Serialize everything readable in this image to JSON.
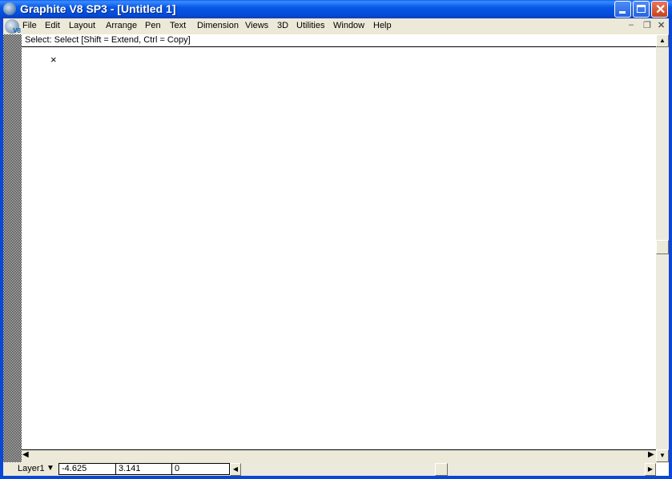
{
  "window": {
    "title": "Graphite V8 SP3 - [Untitled 1]",
    "minimize_icon": "minimize-icon",
    "maximize_icon": "maximize-icon",
    "close_icon": "close-icon"
  },
  "menubar": {
    "items": [
      "File",
      "Edit",
      "Layout",
      "Arrange",
      "Pen",
      "Text",
      "Dimension",
      "Views",
      "3D",
      "Utilities",
      "Window",
      "Help"
    ],
    "doc_icon_badge": "V8"
  },
  "prompt": {
    "text": "Select: Select  [Shift = Extend, Ctrl = Copy]"
  },
  "canvas": {
    "marker": "×"
  },
  "statusbar": {
    "layer": "Layer1",
    "x": "-4.625",
    "y": "3.141",
    "z": "0"
  }
}
